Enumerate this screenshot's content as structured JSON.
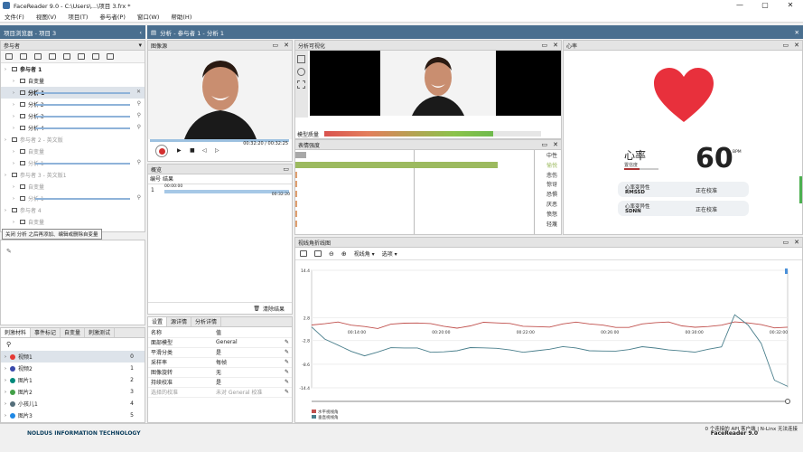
{
  "window": {
    "title": "FaceReader 9.0 - C:\\Users\\...\\项目 3.frx *",
    "controls": [
      "—",
      "▢",
      "✕"
    ]
  },
  "menu": [
    "文件(F)",
    "视图(V)",
    "项目(T)",
    "参与者(P)",
    "窗口(W)",
    "帮助(H)"
  ],
  "tabs": {
    "left": "项目浏览器 - 项目 3",
    "right": "分析 - 参与者 1 - 分析 1"
  },
  "participants_panel": {
    "title": "参与者",
    "tooltip": "关闭 分析 之后再添加、编辑或删除自变量",
    "tree": [
      {
        "label": "参与者 1",
        "level": 0,
        "bold": true,
        "grey": false
      },
      {
        "label": "自变量",
        "level": 1,
        "grey": false
      },
      {
        "label": "分析 1",
        "level": 1,
        "grey": false,
        "bold": true,
        "selected": true,
        "bar": true,
        "close": true
      },
      {
        "label": "分析 2",
        "level": 1,
        "grey": false,
        "bar": true,
        "mag": true
      },
      {
        "label": "分析 3",
        "level": 1,
        "grey": false,
        "bar": true,
        "mag": true
      },
      {
        "label": "分析 4",
        "level": 1,
        "grey": false,
        "bar": true,
        "mag": true
      },
      {
        "label": "参与者 2 - 英文版",
        "level": 0,
        "grey": true
      },
      {
        "label": "自变量",
        "level": 1,
        "grey": true
      },
      {
        "label": "分析 1",
        "level": 1,
        "grey": true,
        "bar": true,
        "mag": true
      },
      {
        "label": "参与者 3 - 英文版1",
        "level": 0,
        "grey": true
      },
      {
        "label": "自变量",
        "level": 1,
        "grey": true
      },
      {
        "label": "分析 1",
        "level": 1,
        "grey": true,
        "bar": true,
        "mag": true
      },
      {
        "label": "参与者 4",
        "level": 0,
        "grey": true
      },
      {
        "label": "自变量",
        "level": 1,
        "grey": true
      }
    ]
  },
  "stimuli_panel": {
    "tabs": [
      "刺激材料",
      "事件标记",
      "自变量",
      "刺激测试"
    ],
    "items": [
      {
        "label": "视频1",
        "num": "0",
        "color": "#e53935"
      },
      {
        "label": "视频2",
        "num": "1",
        "color": "#3949ab"
      },
      {
        "label": "图片1",
        "num": "2",
        "color": "#00897b"
      },
      {
        "label": "图片2",
        "num": "3",
        "color": "#43a047"
      },
      {
        "label": "小孩儿1",
        "num": "4",
        "color": "#546e7a"
      },
      {
        "label": "图片3",
        "num": "5",
        "color": "#1e88e5"
      }
    ]
  },
  "image_source": {
    "title": "图像源",
    "time": "00:32:20 / 00:32:25"
  },
  "overview": {
    "title": "概览",
    "col1": "编号",
    "col2": "结果",
    "row_num": "1",
    "row_time": "00:00:00",
    "row_end": "00:32:20",
    "clear": "清除结果"
  },
  "settings": {
    "tabs": [
      "设置",
      "源详情",
      "分析详情"
    ],
    "col1": "名称",
    "col2": "值",
    "rows": [
      {
        "name": "面部模型",
        "value": "General"
      },
      {
        "name": "平滑分类",
        "value": "是"
      },
      {
        "name": "采样率",
        "value": "每帧"
      },
      {
        "name": "图像旋转",
        "value": "无"
      },
      {
        "name": "持续校准",
        "value": "是"
      },
      {
        "name": "选择的校准",
        "value": "未对 General 校准"
      }
    ]
  },
  "visualization": {
    "title": "分析可视化",
    "quality_label": "模型质量"
  },
  "expression": {
    "title": "表情强度",
    "emotions": [
      "中性",
      "愉悦",
      "悲伤",
      "惊讶",
      "恐惧",
      "厌恶",
      "愤怒",
      "轻蔑"
    ],
    "intensity": [
      0.05,
      0.92,
      0.01,
      0.01,
      0.01,
      0.01,
      0.01,
      0.01
    ]
  },
  "heart": {
    "title": "心率",
    "hr_label": "心率",
    "hr_value": "60",
    "hr_unit": "BPM",
    "trust_label": "置信度",
    "hrv1_label": "心率变异性",
    "hrv1_metric": "RMSSD",
    "hrv1_value": "正在校准",
    "hrv2_label": "心率变异性",
    "hrv2_metric": "SDNN",
    "hrv2_value": "正在校准"
  },
  "gaze": {
    "title": "视线角折线图",
    "toolbar_dd1": "视线角",
    "toolbar_dd2": "选项",
    "chart_data": {
      "type": "line",
      "x_ticks": [
        "00:14:00",
        "00:20:00",
        "00:22:00",
        "00:26:00",
        "00:30:00",
        "00:32:00"
      ],
      "y_ticks": [
        "14.4",
        "2.8",
        "-2.8",
        "-8.6",
        "-14.4"
      ],
      "ylim": [
        -14.4,
        14.4
      ],
      "series": [
        {
          "name": "水平视线角",
          "color": "#c0504d",
          "values": [
            1,
            0.8,
            1.2,
            0.9,
            1.1,
            0.7,
            1.3,
            1.0,
            0.9,
            1.2,
            1.1,
            0.8,
            1.0,
            1.3,
            0.9,
            1.1,
            1.0,
            1.2,
            0.8,
            1.0,
            1.1,
            0.9,
            1.2,
            1.0,
            0.8,
            1.1,
            1.0,
            1.3,
            0.9,
            1.0,
            1.1,
            0.9,
            1.2,
            1.0,
            1.1,
            0.8,
            1.0
          ]
        },
        {
          "name": "垂直视线角",
          "color": "#4a7f8c",
          "values": [
            0,
            -3,
            -4,
            -5,
            -6,
            -5.5,
            -5,
            -5.2,
            -4.8,
            -5.3,
            -5,
            -5.1,
            -4.9,
            -5.2,
            -5,
            -4.8,
            -5.1,
            -5,
            -5.2,
            -4.9,
            -5,
            -5.1,
            -4.8,
            -5,
            -5.2,
            -4.9,
            -5.1,
            -5,
            -4.8,
            -5.2,
            -5,
            -4.9,
            3,
            1,
            -3,
            -12,
            -14
          ]
        }
      ]
    }
  },
  "status": {
    "right": "0 个连接的 API 客户端 | N-Linx 无法连接",
    "brand": "NOLDUS INFORMATION TECHNOLOGY",
    "product": "FaceReader 9.0"
  }
}
